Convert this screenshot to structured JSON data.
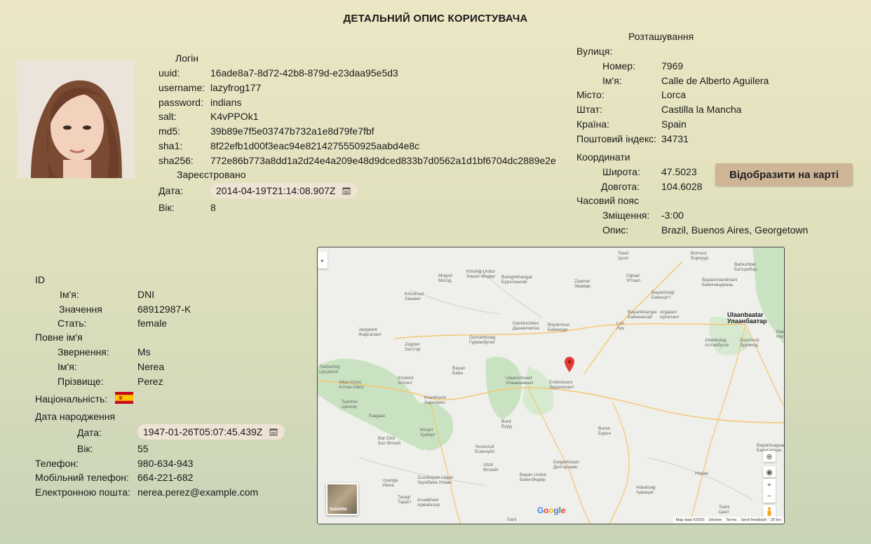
{
  "title": "ДЕТАЛЬНИЙ ОПИС КОРИСТУВАЧА",
  "login": {
    "heading": "Логін",
    "fields": [
      {
        "label": "uuid:",
        "value": "16ade8a7-8d72-42b8-879d-e23daa95e5d3"
      },
      {
        "label": "username:",
        "value": "lazyfrog177"
      },
      {
        "label": "password:",
        "value": "indians"
      },
      {
        "label": "salt:",
        "value": "K4vPPOk1"
      },
      {
        "label": "md5:",
        "value": "39b89e7f5e03747b732a1e8d79fe7fbf"
      },
      {
        "label": "sha1:",
        "value": "8f22efb1d00f3eac94e8214275550925aabd4e8c"
      },
      {
        "label": "sha256:",
        "value": "772e86b773a8dd1a2d24e4a209e48d9dced833b7d0562a1d1bf6704dc2889e2e"
      }
    ]
  },
  "registered": {
    "heading": "Зареєстровано",
    "date_label": "Дата:",
    "date_value": "2014-04-19T21:14:08.907Z",
    "age_label": "Вік:",
    "age_value": "8"
  },
  "location": {
    "heading": "Розташування",
    "street_label": "Вулиця:",
    "number_label": "Номер:",
    "number_value": "7969",
    "street_name_label": "Ім'я:",
    "street_name_value": "Calle de Alberto Aguilera",
    "city_label": "Місто:",
    "city_value": "Lorca",
    "state_label": "Штат:",
    "state_value": "Castilla la Mancha",
    "country_label": "Країна:",
    "country_value": "Spain",
    "postcode_label": "Поштовий індекс:",
    "postcode_value": "34731",
    "coords_label": "Координати",
    "lat_label": "Широта:",
    "lat_value": "47.5023",
    "lon_label": "Довгота:",
    "lon_value": "104.6028",
    "tz_label": "Часовий пояс",
    "offset_label": "Зміщення:",
    "offset_value": "-3:00",
    "desc_label": "Опис:",
    "desc_value": "Brazil, Buenos Aires, Georgetown",
    "map_button": "Відобразити на карті"
  },
  "identity": {
    "id_heading": "ID",
    "id_name_label": "Ім'я:",
    "id_name_value": "DNI",
    "id_value_label": "Значення",
    "id_value_value": "68912987-K",
    "gender_label": "Стать:",
    "gender_value": "female",
    "fullname_heading": "Повне ім'я",
    "title_label": "Звернення:",
    "title_value": "Ms",
    "first_label": "Ім'я:",
    "first_value": "Nerea",
    "last_label": "Прізвище:",
    "last_value": "Perez",
    "nat_label": "Національність:",
    "nat_flag_icon": "spain-flag-icon",
    "dob_heading": "Дата народження",
    "dob_date_label": "Дата:",
    "dob_date_value": "1947-01-26T05:07:45.439Z",
    "dob_age_label": "Вік:",
    "dob_age_value": "55",
    "phone_label": "Телефон:",
    "phone_value": "980-634-943",
    "cell_label": "Мобільний телефон:",
    "cell_value": "664-221-682",
    "email_label": "Електронною поштa:",
    "email_value": "nerea.perez@example.com"
  },
  "map": {
    "satellite_label": "Satellite",
    "google_logo": "Google",
    "footer": [
      "Map data ©2020",
      "Ukraine",
      "Terms",
      "Send feedback",
      "20 km"
    ],
    "places": [
      {
        "name": "Tsetserleg\nЦэцэрлэг"
      },
      {
        "name": "Jargalant\nЖаргалант"
      },
      {
        "name": "Khushuut\nХөшөөт"
      },
      {
        "name": "Mogod\nМогод"
      },
      {
        "name": "Khishig-Undur\nХишиг-Өндөр"
      },
      {
        "name": "Bureghkhangai\nБүрэгхангай"
      },
      {
        "name": "Zaamar\nЗаамар"
      },
      {
        "name": "Tseel\nЦээл"
      },
      {
        "name": "Ugtaal\nУгтаал"
      },
      {
        "name": "Bornuur\nБорнуур"
      },
      {
        "name": "Batsumber\nБатсүмбэр"
      },
      {
        "name": "Bayanchandmani\nБаянчандмань"
      },
      {
        "name": "Bayantsogt\nБаянцогт"
      },
      {
        "name": "Bayankhangai\nБаянхангай"
      },
      {
        "name": "Argalant\nАргалант"
      },
      {
        "name": "Lun\nЛүн"
      },
      {
        "name": "Dashinchilen\nДашинчилэн"
      },
      {
        "name": "Bayannuur\nБаяннуур"
      },
      {
        "name": "Gurvanbulag\nГурванбулаг"
      },
      {
        "name": "Zegster\nЗэгстэр"
      },
      {
        "name": "Bayan\nБаян"
      },
      {
        "name": "Khotont\nХотонт"
      },
      {
        "name": "Altan-Ovoo\nАлтан-Овоо"
      },
      {
        "name": "Ulaanshiveet\nУлааншивээт"
      },
      {
        "name": "Erdenesant\nЭрдэнэсант"
      },
      {
        "name": "Tsenher\nЦэнхэр"
      },
      {
        "name": "Kharkhorin\nХархорин"
      },
      {
        "name": "Tsagaan"
      },
      {
        "name": "Khujirt\nХужирт"
      },
      {
        "name": "Bat Olzii\nБат-Өлзий"
      },
      {
        "name": "Burd\nБүрд"
      },
      {
        "name": "Buren\nБүрэн"
      },
      {
        "name": "Yesunzuil\nЕсөнзүйл"
      },
      {
        "name": "Ulziit\nӨлзийт"
      },
      {
        "name": "Bayan-Undur\nБаян-Өндөр"
      },
      {
        "name": "Zuunbayan-Ulaan\nЗүүнбаян-Улаан"
      },
      {
        "name": "Uyanga\nУянга"
      },
      {
        "name": "Taragt\nТарагт"
      },
      {
        "name": "Arvaikheer\nАрвайхээр"
      },
      {
        "name": "Delgerkhaan\nДэлгэрхаан"
      },
      {
        "name": "Adaatsag\nАдаацаг"
      },
      {
        "name": "Hayaa"
      },
      {
        "name": "Tsant\nЦант"
      },
      {
        "name": "Altanbulag\nАлтанбулаг"
      },
      {
        "name": "Zuunmod\nЗуунмод"
      },
      {
        "name": "Bayantsagaan\nБаянцагаан"
      },
      {
        "name": "Sant"
      },
      {
        "name": "Nalaikh\nНалайх"
      },
      {
        "name": "Ulaanbaatar\nУлаанбаатар"
      }
    ]
  }
}
